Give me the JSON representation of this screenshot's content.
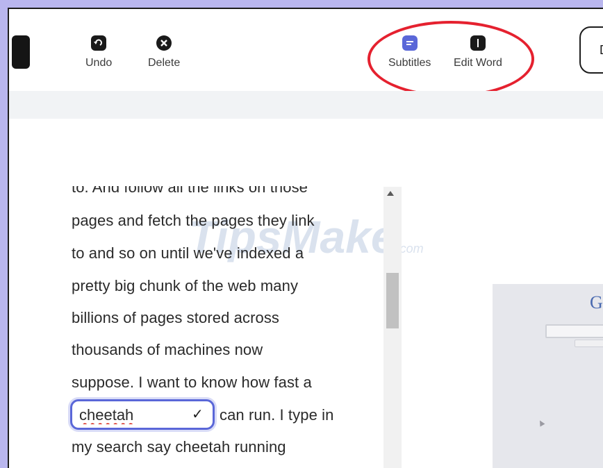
{
  "toolbar": {
    "undo_label": "Undo",
    "delete_label": "Delete",
    "subtitles_label": "Subtitles",
    "edit_word_label": "Edit Word",
    "right_button_peek": "D"
  },
  "transcript": {
    "lines": [
      "to. And follow all the links on those",
      "pages and fetch the pages they link",
      "to and so on until we've indexed a",
      "pretty big chunk of the web many",
      "billions of pages stored across",
      "thousands of machines now",
      "suppose. I want to know how fast a",
      "can run. I type in",
      "my search say cheetah running"
    ],
    "edit_word_value": "cheetah",
    "confirm_icon": "check-icon"
  },
  "watermark": {
    "text": "TipsMake",
    "suffix": ".com"
  },
  "video": {
    "logo_letter": "G"
  },
  "colors": {
    "accent": "#5a67d8",
    "highlight_ellipse": "#e5212f",
    "page_background": "#b9b6ee"
  }
}
